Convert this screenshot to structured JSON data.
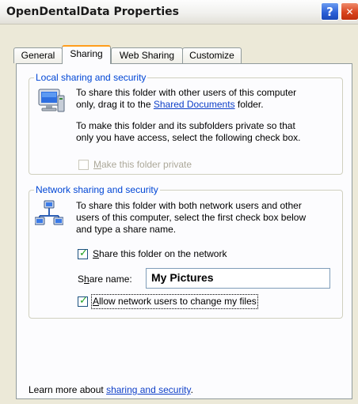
{
  "window": {
    "title": "OpenDentalData Properties",
    "help_label": "?",
    "close_label": "✕"
  },
  "tabs": [
    {
      "label": "General"
    },
    {
      "label": "Sharing"
    },
    {
      "label": "Web Sharing"
    },
    {
      "label": "Customize"
    }
  ],
  "local": {
    "legend": "Local sharing and security",
    "line1": "To share this folder with other users of this computer",
    "line2_pre": "only, drag it to the ",
    "line2_link": "Shared Documents",
    "line2_post": " folder.",
    "line3": "To make this folder and its subfolders private so that",
    "line4": "only you have access, select the following check box.",
    "private_checkbox": {
      "label_u": "M",
      "label_rest": "ake this folder private",
      "checked": false,
      "enabled": false
    }
  },
  "network": {
    "legend": "Network sharing and security",
    "line1": "To share this folder with both network users and other",
    "line2": "users of this computer, select the first check box below",
    "line3": "and type a share name.",
    "share_checkbox": {
      "label_u": "S",
      "label_rest": "hare this folder on the network",
      "checked": true
    },
    "share_name_label_pre": "S",
    "share_name_label_u": "h",
    "share_name_label_post": "are name:",
    "share_name_value": "My Pictures",
    "allow_checkbox": {
      "label_u": "A",
      "label_rest": "llow network users to change my files",
      "checked": true
    }
  },
  "footer": {
    "text": "Learn more about ",
    "link": "sharing and security",
    "post": "."
  },
  "colors": {
    "legend": "#0046d5",
    "link": "#0e3fc8",
    "active_tab_accent": "#ff9d1c",
    "window_bg": "#ece9d8"
  }
}
